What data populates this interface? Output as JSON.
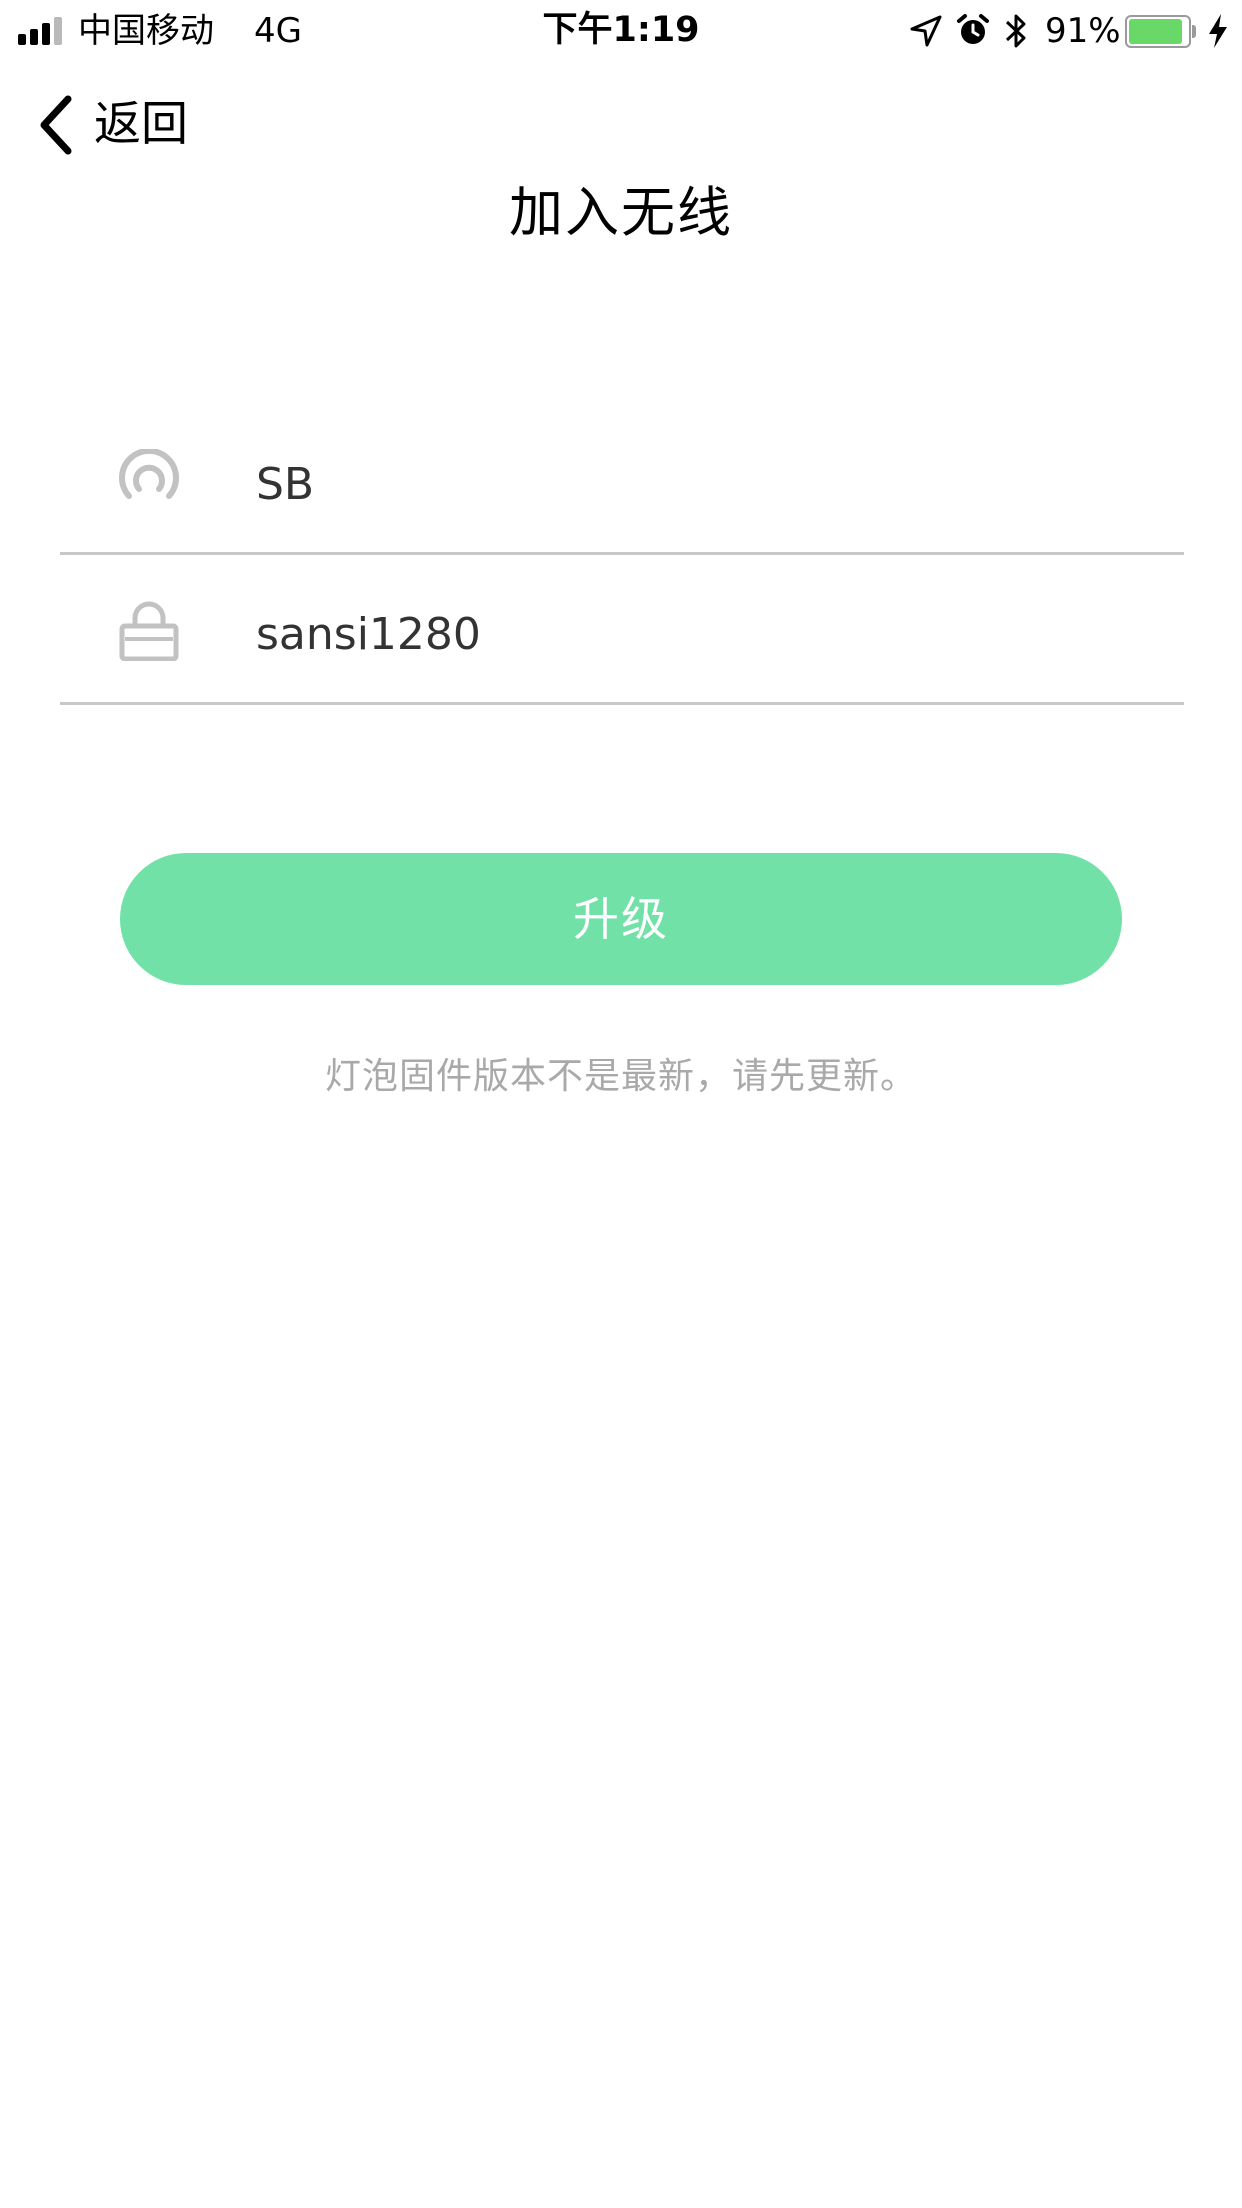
{
  "status_bar": {
    "carrier": "中国移动",
    "network": "4G",
    "time": "下午1:19",
    "battery_percent": "91%",
    "battery_level": 0.91,
    "battery_color": "#6ad868",
    "icons": [
      "signal-icon",
      "location-icon",
      "alarm-icon",
      "bluetooth-icon",
      "battery-icon",
      "charging-icon"
    ]
  },
  "nav": {
    "back_label": "返回",
    "back_icon": "chevron-left-icon"
  },
  "page": {
    "title": "加入无线"
  },
  "form": {
    "ssid": {
      "icon": "wifi-icon",
      "value": "SB"
    },
    "password": {
      "icon": "lock-icon",
      "value": "sansi1280"
    }
  },
  "upgrade_button": {
    "label": "升级",
    "color": "#72e1a8"
  },
  "hint": "灯泡固件版本不是最新，请先更新。",
  "colors": {
    "icon_gray": "#c2c2c2",
    "divider": "#c8c8c8",
    "hint_text": "#a9a9a9"
  }
}
